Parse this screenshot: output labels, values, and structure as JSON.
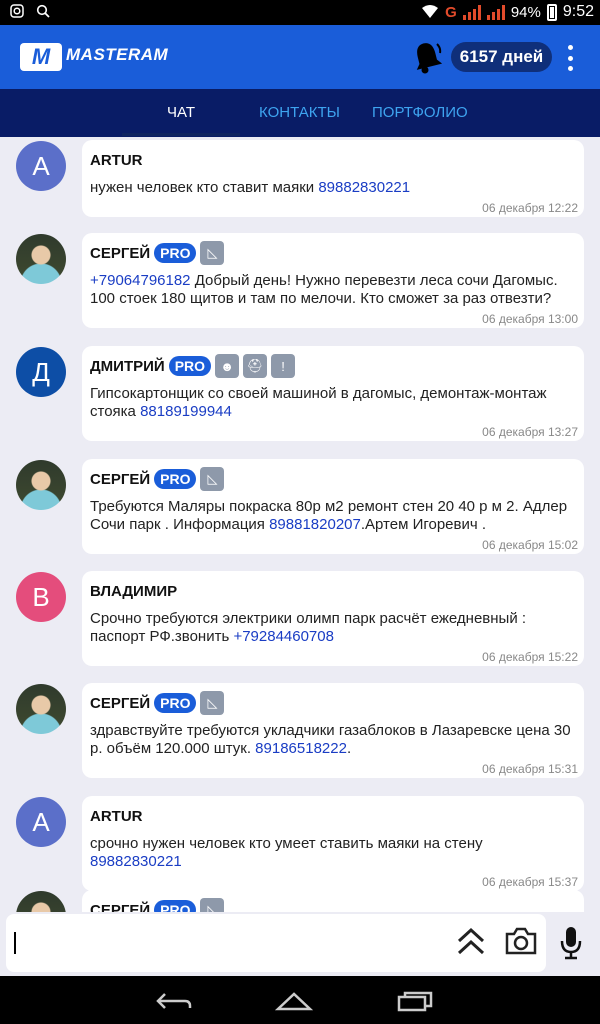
{
  "status_bar": {
    "battery": "94%",
    "time": "9:52",
    "network": "G"
  },
  "app": {
    "logo_mark": "M",
    "name": "MASTERAM",
    "days_badge": "6157 дней"
  },
  "tabs": [
    {
      "label": "ЧАТ",
      "active": true
    },
    {
      "label": "КОНТАКТЫ",
      "active": false
    },
    {
      "label": "ПОРТФОЛИО",
      "active": false
    }
  ],
  "messages": [
    {
      "avatar_letter": "A",
      "avatar_color": "#5b6fc9",
      "name": "ARTUR",
      "pro": false,
      "text_before": "нужен человек кто ставит маяки ",
      "phone": "89882830221",
      "text_after": "",
      "time": "06 декабря 12:22"
    },
    {
      "avatar_letter": "",
      "avatar_color": "photo",
      "name": "СЕРГЕЙ",
      "pro": true,
      "pro_label": "PRO",
      "text_before": "",
      "phone": "+79064796182",
      "text_after": " Добрый день! Нужно перевезти леса сочи Дагомыс. 100 стоек 180 щитов и там по мелочи. Кто сможет за раз отвезти?",
      "time": "06 декабря 13:00"
    },
    {
      "avatar_letter": "Д",
      "avatar_color": "#0d4ea6",
      "name": "ДМИТРИЙ",
      "pro": true,
      "pro_label": "PRO",
      "text_before": "Гипсокартонщик со своей машиной в дагомыс, демонтаж-монтаж стояка ",
      "phone": "88189199944",
      "text_after": "",
      "time": "06 декабря 13:27"
    },
    {
      "avatar_letter": "",
      "avatar_color": "photo",
      "name": "СЕРГЕЙ",
      "pro": true,
      "pro_label": "PRO",
      "text_before": "Требуются Маляры покраска 80р м2 ремонт стен 20 40 р м 2. Адлер Сочи парк . Информация ",
      "phone": "89881820207",
      "text_after": ".Артем Игоревич .",
      "time": "06 декабря 15:02"
    },
    {
      "avatar_letter": "В",
      "avatar_color": "#e44d7c",
      "name": "ВЛАДИМИР",
      "pro": false,
      "text_before": "Срочно требуются электрики олимп парк расчёт ежедневный : паспорт РФ.звонить  ",
      "phone": "+79284460708",
      "text_after": "",
      "time": "06 декабря 15:22"
    },
    {
      "avatar_letter": "",
      "avatar_color": "photo",
      "name": "СЕРГЕЙ",
      "pro": true,
      "pro_label": "PRO",
      "text_before": "здравствуйте требуются укладчики газаблоков в Лазаревске   цена 30 р.  объём 120.000 штук.  ",
      "phone": "89186518222",
      "text_after": ".",
      "time": "06 декабря 15:31"
    },
    {
      "avatar_letter": "A",
      "avatar_color": "#5b6fc9",
      "name": "ARTUR",
      "pro": false,
      "text_before": "срочно нужен человек кто умеет ставить маяки на стену ",
      "phone": "89882830221",
      "text_after": "",
      "time": "06 декабря 15:37"
    },
    {
      "avatar_letter": "",
      "avatar_color": "photo",
      "name": "СЕРГЕЙ",
      "pro": true,
      "pro_label": "PRO",
      "text_before": "",
      "phone": "",
      "text_after": "",
      "time": ""
    }
  ],
  "input": {
    "placeholder": ""
  },
  "icons": [
    "wifi-icon",
    "camera-icon",
    "search-icon",
    "bell-icon",
    "kebab-menu-icon",
    "scroll-up-icon",
    "camera-attach-icon",
    "microphone-icon",
    "back-icon",
    "home-icon",
    "recents-icon"
  ]
}
